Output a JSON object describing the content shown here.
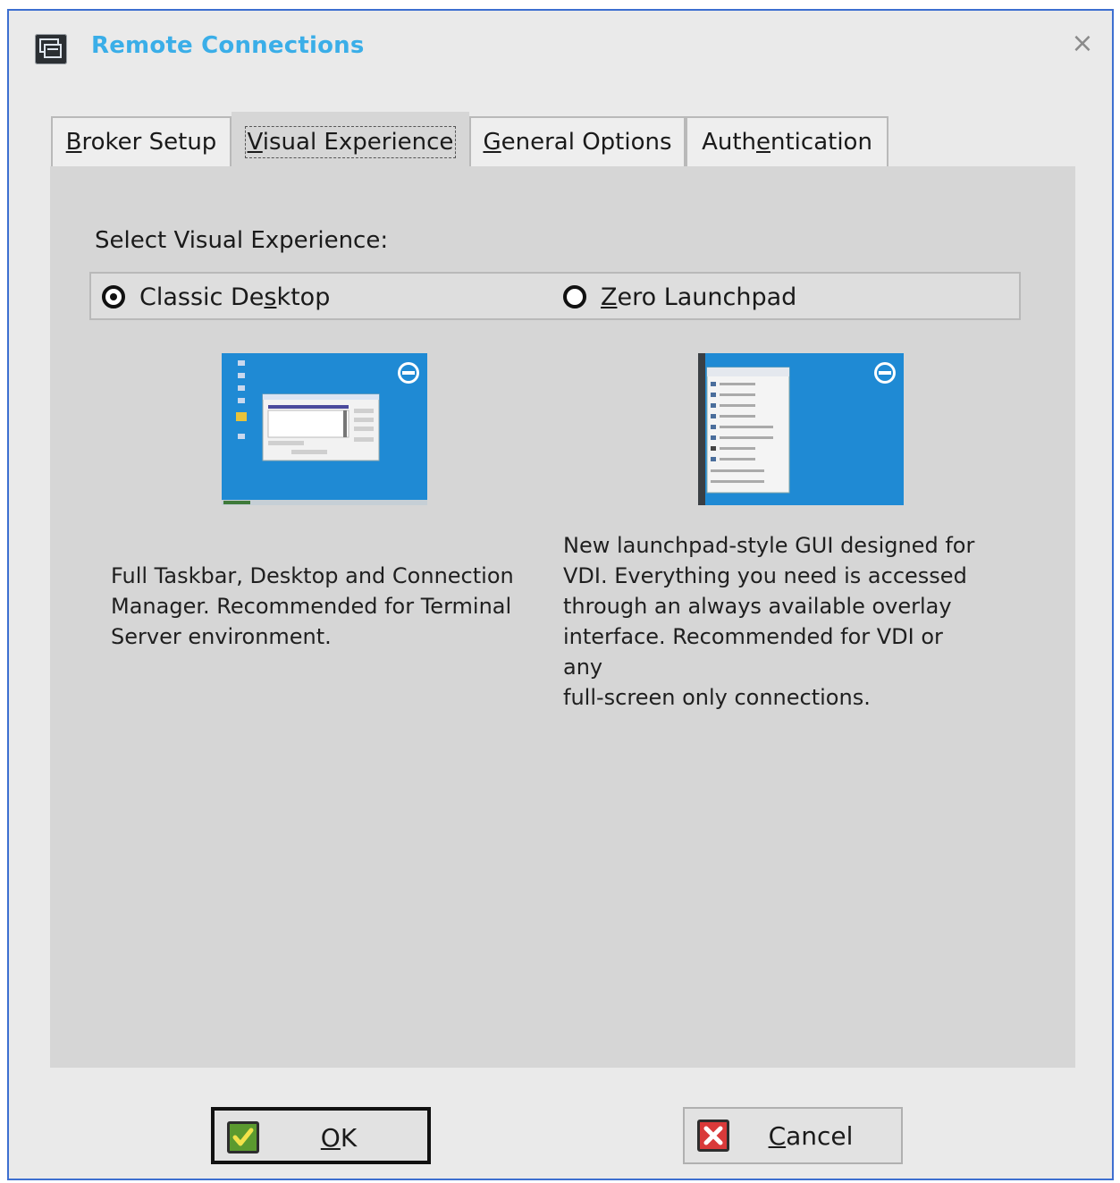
{
  "window": {
    "title": "Remote Connections",
    "close_glyph": "×",
    "icon": "remote-connections-icon"
  },
  "tabs": [
    {
      "label": "Broker Setup",
      "underline_index": 0,
      "active": false
    },
    {
      "label": "Visual Experience",
      "underline_index": 0,
      "active": true
    },
    {
      "label": "General Options",
      "underline_index": 0,
      "active": false
    },
    {
      "label": "Authentication",
      "underline_index": 4,
      "active": false
    }
  ],
  "panel": {
    "select_label": "Select Visual Experience:",
    "options": [
      {
        "label": "Classic Desktop",
        "underline_index": 10,
        "checked": true
      },
      {
        "label": "Zero Launchpad",
        "underline_index": 0,
        "checked": false
      }
    ],
    "classic_description": "Full Taskbar, Desktop and Connection\nManager. Recommended for Terminal\nServer environment.",
    "zero_description": "New launchpad-style GUI designed for\nVDI. Everything you need is accessed\nthrough an always available overlay\ninterface. Recommended for VDI or any\nfull-screen only connections."
  },
  "buttons": {
    "ok_label": "OK",
    "ok_icon": "checkmark-icon",
    "cancel_label": "Cancel",
    "cancel_icon": "x-icon"
  },
  "colors": {
    "title": "#3aaee8",
    "preview_bg": "#1f8ad4",
    "window_border": "#3d6fd0"
  }
}
